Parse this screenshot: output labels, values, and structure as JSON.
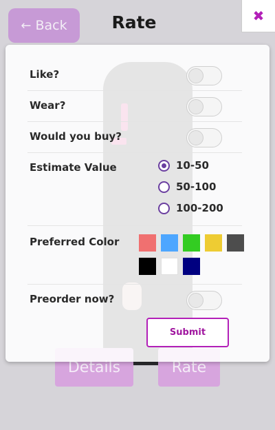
{
  "header": {
    "back_label": "Back",
    "title": "Rate",
    "close_symbol": "✖"
  },
  "background": {
    "details_label": "Details",
    "rate_label": "Rate"
  },
  "form": {
    "like_label": "Like?",
    "wear_label": "Wear?",
    "buy_label": "Would you buy?",
    "estimate_label": "Estimate Value",
    "estimate_options": [
      "10-50",
      "50-100",
      "100-200"
    ],
    "estimate_selected": "10-50",
    "color_label": "Preferred Color",
    "colors": [
      "#f07070",
      "#4da6ff",
      "#33cc22",
      "#eecc33",
      "#4d4d4d",
      "#000000",
      "#ffffff",
      "#000080"
    ],
    "preorder_label": "Preorder now?",
    "toggles": {
      "like": false,
      "wear": false,
      "buy": false,
      "preorder": false
    },
    "submit_label": "Submit"
  },
  "theme": {
    "accent": "#b21fb8",
    "radio": "#6b3fa0"
  }
}
